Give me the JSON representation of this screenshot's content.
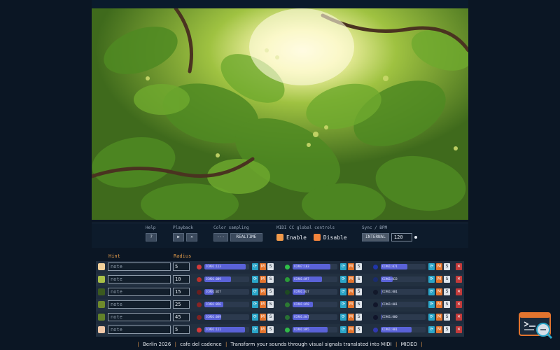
{
  "controls": {
    "help": {
      "label": "Help",
      "button": "?"
    },
    "playback": {
      "label": "Playback",
      "play": "▶",
      "stop": "✕"
    },
    "color_sampling": {
      "label": "Color sampling",
      "dots": "···",
      "mode": "REALTIME"
    },
    "midi": {
      "label": "MIDI CC global controls",
      "enable": "Enable",
      "disable": "Disable"
    },
    "sync": {
      "label": "Sync / BPM",
      "mode": "INTERNAL",
      "bpm": "120"
    }
  },
  "table": {
    "hint_header": "Hint",
    "radius_header": "Radius",
    "rows": [
      {
        "swatch": "#f2d09a",
        "hint": "note",
        "radius": "5",
        "channels": [
          {
            "dot": "#d43a3a",
            "code": "CC#01:113",
            "fill": 0.92
          },
          {
            "dot": "#2fbf48",
            "code": "CC#07:103",
            "fill": 0.85
          },
          {
            "dot": "#2035a8",
            "code": "CC#01:071",
            "fill": 0.6
          }
        ]
      },
      {
        "swatch": "#a8bf48",
        "hint": "note",
        "radius": "10",
        "channels": [
          {
            "dot": "#b8302a",
            "code": "CC#01:089",
            "fill": 0.6
          },
          {
            "dot": "#2a9b38",
            "code": "CC#01:097",
            "fill": 0.66
          },
          {
            "dot": "#1a2b6e",
            "code": "CC#01:033",
            "fill": 0.26
          }
        ]
      },
      {
        "swatch": "#3b5a1f",
        "hint": "note",
        "radius": "15",
        "channels": [
          {
            "dot": "#6a1e1e",
            "code": "CC#01:027",
            "fill": 0.2
          },
          {
            "dot": "#1e4a22",
            "code": "CC#01:037",
            "fill": 0.28
          },
          {
            "dot": "#12182a",
            "code": "CC#01:001",
            "fill": 0.02
          }
        ]
      },
      {
        "swatch": "#6f8a2c",
        "hint": "note",
        "radius": "25",
        "channels": [
          {
            "dot": "#8a2424",
            "code": "CC#01:056",
            "fill": 0.42
          },
          {
            "dot": "#2c7a32",
            "code": "CC#01:058",
            "fill": 0.45
          },
          {
            "dot": "#11162a",
            "code": "CC#01:001",
            "fill": 0.02
          }
        ]
      },
      {
        "swatch": "#62822a",
        "hint": "note",
        "radius": "45",
        "channels": [
          {
            "dot": "#7e2222",
            "code": "CC#01:049",
            "fill": 0.38
          },
          {
            "dot": "#287034",
            "code": "CC#01:047",
            "fill": 0.36
          },
          {
            "dot": "#10142a",
            "code": "CC#01:000",
            "fill": 0.01
          }
        ]
      },
      {
        "swatch": "#f0c8a8",
        "hint": "note",
        "radius": "5",
        "channels": [
          {
            "dot": "#d43838",
            "code": "CC#01:111",
            "fill": 0.9
          },
          {
            "dot": "#30b848",
            "code": "CC#01:095",
            "fill": 0.78
          },
          {
            "dot": "#3138b0",
            "code": "CC#01:081",
            "fill": 0.68
          }
        ]
      }
    ]
  },
  "footer": {
    "year": "Berlin 2026",
    "credit": "cafe del cadence",
    "tagline": "Transform your sounds through visual signals translated into MIDI",
    "brand": "MIDEO"
  },
  "icons": {
    "channel_buttons": [
      "refresh-icon",
      "m-icon",
      "s-icon"
    ],
    "corner": "terminal-search-icon"
  },
  "colors": {
    "accent": "#e2742e",
    "cyan": "#2aa5c8",
    "bar": "#5a62d8",
    "background": "#0b1624"
  }
}
